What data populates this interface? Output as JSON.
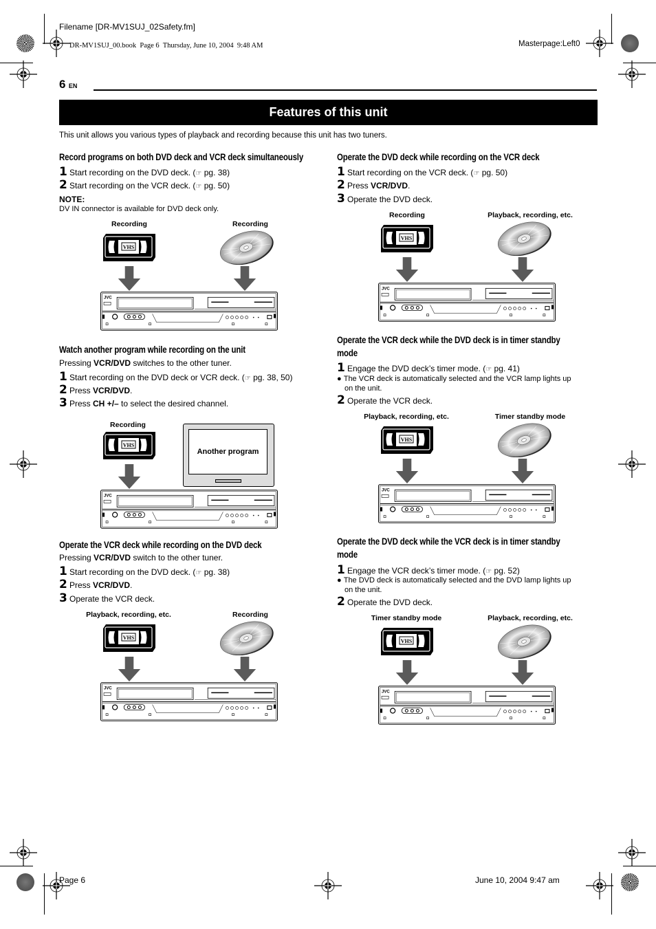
{
  "print_slug": {
    "filename": "Filename [DR-MV1SUJ_02Safety.fm]",
    "book_line": "DR-MV1SUJ_00.book  Page 6  Thursday, June 10, 2004  9:48 AM",
    "masterpage": "Masterpage:Left0",
    "footer_page": "Page 6",
    "footer_date": "June 10, 2004 9:47 am"
  },
  "header": {
    "page_number": "6",
    "language": "EN"
  },
  "title": "Features of this unit",
  "intro": "This unit allows you various types of playback and recording because this unit has two tuners.",
  "ref_icon": "pointing-hand-icon",
  "sections": {
    "simultaneous": {
      "heading": "Record programs on both DVD deck and VCR deck simultaneously",
      "steps": [
        {
          "num": "1",
          "text": "Start recording on the DVD deck. (",
          "ref": "pg. 38",
          "after": ")"
        },
        {
          "num": "2",
          "text": "Start recording on the VCR deck. (",
          "ref": "pg. 50",
          "after": ")"
        }
      ],
      "note_heading": "NOTE:",
      "note_text": "DV IN connector is available for DVD deck only.",
      "diagram": {
        "left_label": "Recording",
        "right_label": "Recording"
      }
    },
    "watch_another": {
      "heading": "Watch another program while recording on the unit",
      "intro_pre": "Pressing ",
      "intro_bold": "VCR/DVD",
      "intro_post": " switches to the other tuner.",
      "steps": [
        {
          "num": "1",
          "text": "Start recording on the DVD deck or VCR deck. (",
          "ref": "pg. 38, 50",
          "after": ")"
        },
        {
          "num": "2",
          "pre": "Press ",
          "bold": "VCR/DVD",
          "post": "."
        },
        {
          "num": "3",
          "pre": "Press ",
          "bold": "CH +/–",
          "post": " to select the desired channel."
        }
      ],
      "diagram": {
        "left_label": "Recording",
        "tv_label": "Another program"
      }
    },
    "vcr_while_dvd_rec": {
      "heading": "Operate the VCR deck while recording on the DVD deck",
      "intro_pre": "Pressing ",
      "intro_bold": "VCR/DVD",
      "intro_post": " switch to the other tuner.",
      "steps": [
        {
          "num": "1",
          "text": "Start recording on the DVD deck. (",
          "ref": "pg. 38",
          "after": ")"
        },
        {
          "num": "2",
          "pre": "Press ",
          "bold": "VCR/DVD",
          "post": "."
        },
        {
          "num": "3",
          "text": "Operate the VCR deck."
        }
      ],
      "diagram": {
        "left_label": "Playback, recording, etc.",
        "right_label": "Recording"
      }
    },
    "dvd_while_vcr_rec": {
      "heading": "Operate the DVD deck while recording on the VCR deck",
      "steps": [
        {
          "num": "1",
          "text": "Start recording on the VCR deck. (",
          "ref": "pg. 50",
          "after": ")"
        },
        {
          "num": "2",
          "pre": "Press ",
          "bold": "VCR/DVD",
          "post": "."
        },
        {
          "num": "3",
          "text": "Operate the DVD deck."
        }
      ],
      "diagram": {
        "left_label": "Recording",
        "right_label": "Playback, recording, etc."
      }
    },
    "vcr_while_dvd_timer": {
      "heading_line1": "Operate the VCR deck while the DVD deck is in timer standby",
      "heading_line2": "mode",
      "step1": {
        "num": "1",
        "text": "Engage the DVD deck’s timer mode. (",
        "ref": "pg. 41",
        "after": ")"
      },
      "bullet_line1": "The VCR deck is automatically selected and the VCR lamp lights up",
      "bullet_line2": "on the unit.",
      "step2": {
        "num": "2",
        "text": "Operate the VCR deck."
      },
      "diagram": {
        "left_label": "Playback, recording, etc.",
        "right_label": "Timer standby mode"
      }
    },
    "dvd_while_vcr_timer": {
      "heading_line1": "Operate the DVD deck while the VCR deck is in timer standby",
      "heading_line2": "mode",
      "step1": {
        "num": "1",
        "text": "Engage the VCR deck’s timer mode. (",
        "ref": "pg. 52",
        "after": ")"
      },
      "bullet_line1": "The DVD deck is automatically selected and the DVD lamp lights up",
      "bullet_line2": "on the unit.",
      "step2": {
        "num": "2",
        "text": "Operate the DVD deck."
      },
      "diagram": {
        "left_label": "Timer standby mode",
        "right_label": "Playback, recording, etc."
      }
    }
  },
  "deck_brand": "JVC",
  "vhs_logo": "VHS"
}
